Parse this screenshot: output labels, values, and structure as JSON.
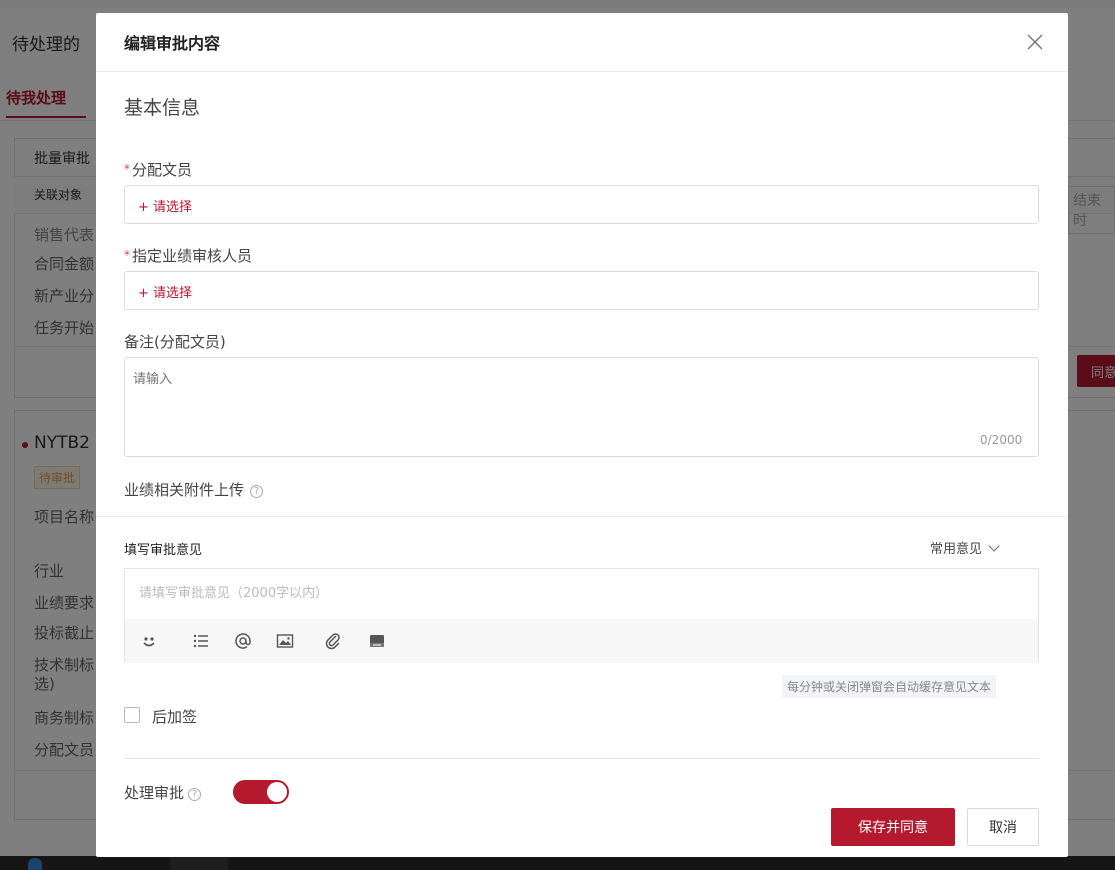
{
  "background": {
    "page_title": "待处理的",
    "tab_pending": "待我处理",
    "batch_approve": "批量审批",
    "related_object": "关联对象",
    "end_time": "结束时",
    "cut_text": "销售代表",
    "fields_top": [
      "合同金额",
      "新产业分",
      "任务开始"
    ],
    "agree_btn": "同意",
    "code": "NYTB2",
    "badge": "待审批",
    "fields_bottom": [
      "项目名称",
      "行业",
      "业绩要求",
      "投标截止",
      "技术制标",
      "选)",
      "商务制标",
      "分配文员"
    ]
  },
  "modal": {
    "title": "编辑审批内容",
    "section_title": "基本信息",
    "assign_clerk_label": "分配文员",
    "assign_clerk_placeholder": "+ 请选择",
    "reviewer_label": "指定业绩审核人员",
    "reviewer_placeholder": "+ 请选择",
    "remark_label": "备注(分配文员)",
    "remark_placeholder": "请输入",
    "remark_count": "0/2000",
    "attachment_label": "业绩相关附件上传",
    "help_glyph": "?",
    "opinion_label": "填写审批意见",
    "common_opinion": "常用意见",
    "opinion_placeholder": "请填写审批意见（2000字以内）",
    "autosave_hint": "每分钟或关闭弹窗会自动缓存意见文本",
    "countersign_label": "后加签",
    "process_label": "处理审批",
    "save_agree": "保存并同意",
    "cancel": "取消"
  },
  "colors": {
    "accent": "#b5192e",
    "required": "#e0464e"
  }
}
